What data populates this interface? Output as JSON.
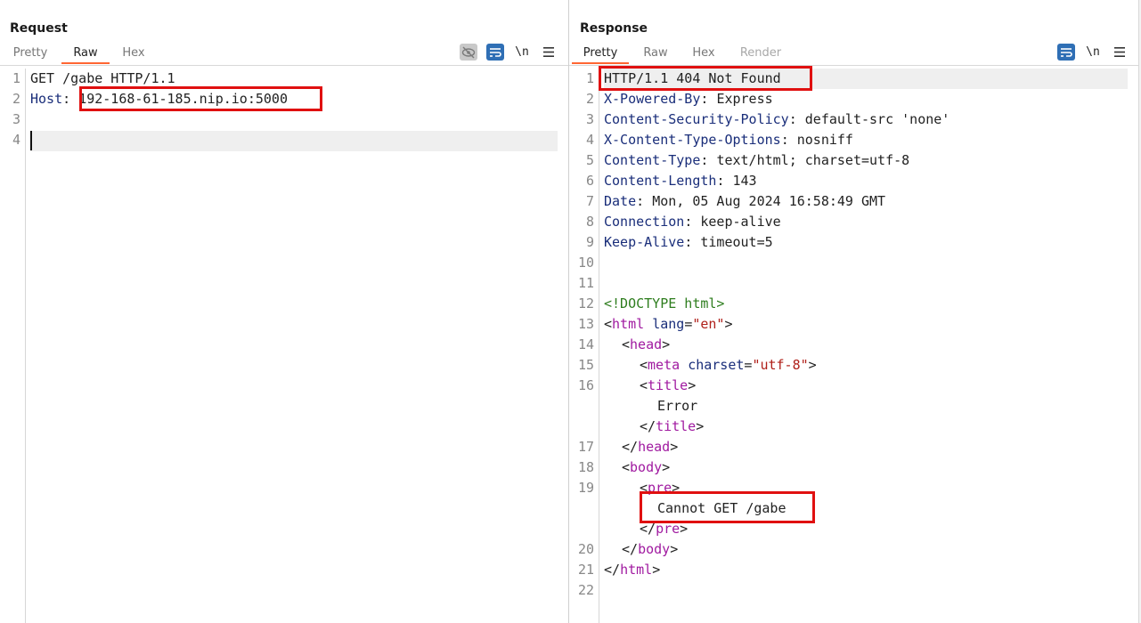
{
  "request": {
    "title": "Request",
    "tabs": [
      "Pretty",
      "Raw",
      "Hex"
    ],
    "active_tab": "Raw",
    "tools": {
      "newline": "\\n",
      "menu": "≡"
    },
    "lines": [
      {
        "n": "1",
        "k": "GET /gabe HTTP/1.1",
        "v": ""
      },
      {
        "n": "2",
        "k": "Host",
        "v": "192-168-61-185.nip.io:5000"
      },
      {
        "n": "3",
        "k": "",
        "v": ""
      },
      {
        "n": "4",
        "k": "",
        "v": ""
      }
    ]
  },
  "response": {
    "title": "Response",
    "tabs": [
      "Pretty",
      "Raw",
      "Hex",
      "Render"
    ],
    "active_tab": "Pretty",
    "tools": {
      "newline": "\\n",
      "menu": "≡"
    },
    "status_line": "HTTP/1.1 404 Not Found",
    "headers": [
      {
        "k": "X-Powered-By",
        "v": "Express"
      },
      {
        "k": "Content-Security-Policy",
        "v": "default-src 'none'"
      },
      {
        "k": "X-Content-Type-Options",
        "v": "nosniff"
      },
      {
        "k": "Content-Type",
        "v": "text/html; charset=utf-8"
      },
      {
        "k": "Content-Length",
        "v": "143"
      },
      {
        "k": "Date",
        "v": "Mon, 05 Aug 2024 16:58:49 GMT"
      },
      {
        "k": "Connection",
        "v": "keep-alive"
      },
      {
        "k": "Keep-Alive",
        "v": "timeout=5"
      }
    ],
    "line_numbers": [
      "1",
      "2",
      "3",
      "4",
      "5",
      "6",
      "7",
      "8",
      "9",
      "10",
      "11",
      "12",
      "13",
      "14",
      "15",
      "16",
      "17",
      "18",
      "19",
      "20",
      "21",
      "22"
    ],
    "html": {
      "doctype": "<!DOCTYPE html>",
      "html_tag": "html",
      "lang_attr": "lang",
      "lang_val": "\"en\"",
      "head_tag": "head",
      "meta_tag": "meta",
      "charset_attr": "charset",
      "charset_val": "\"utf-8\"",
      "title_tag": "title",
      "title_text": "Error",
      "body_tag": "body",
      "pre_tag": "pre",
      "pre_text": "Cannot GET /gabe"
    }
  },
  "colors": {
    "accent": "#ff6633",
    "highlight_box": "#e01010",
    "tool_blue": "#2f6fb5"
  }
}
